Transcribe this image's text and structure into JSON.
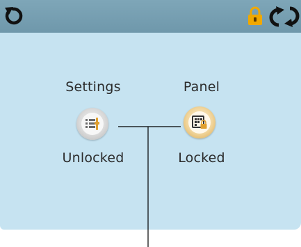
{
  "header": {
    "icons": {
      "back": "back-arrow-icon",
      "lock": "padlock-icon",
      "refresh": "refresh-icon"
    },
    "lock_color": "#f0a800"
  },
  "items": [
    {
      "title": "Settings",
      "status": "Unlocked",
      "icon": "settings-list-icon"
    },
    {
      "title": "Panel",
      "status": "Locked",
      "icon": "panel-keypad-lock-icon"
    }
  ],
  "colors": {
    "topbar": "#7ea6b8",
    "screen_background": "#c6e3f1",
    "callout_line": "#000000"
  }
}
